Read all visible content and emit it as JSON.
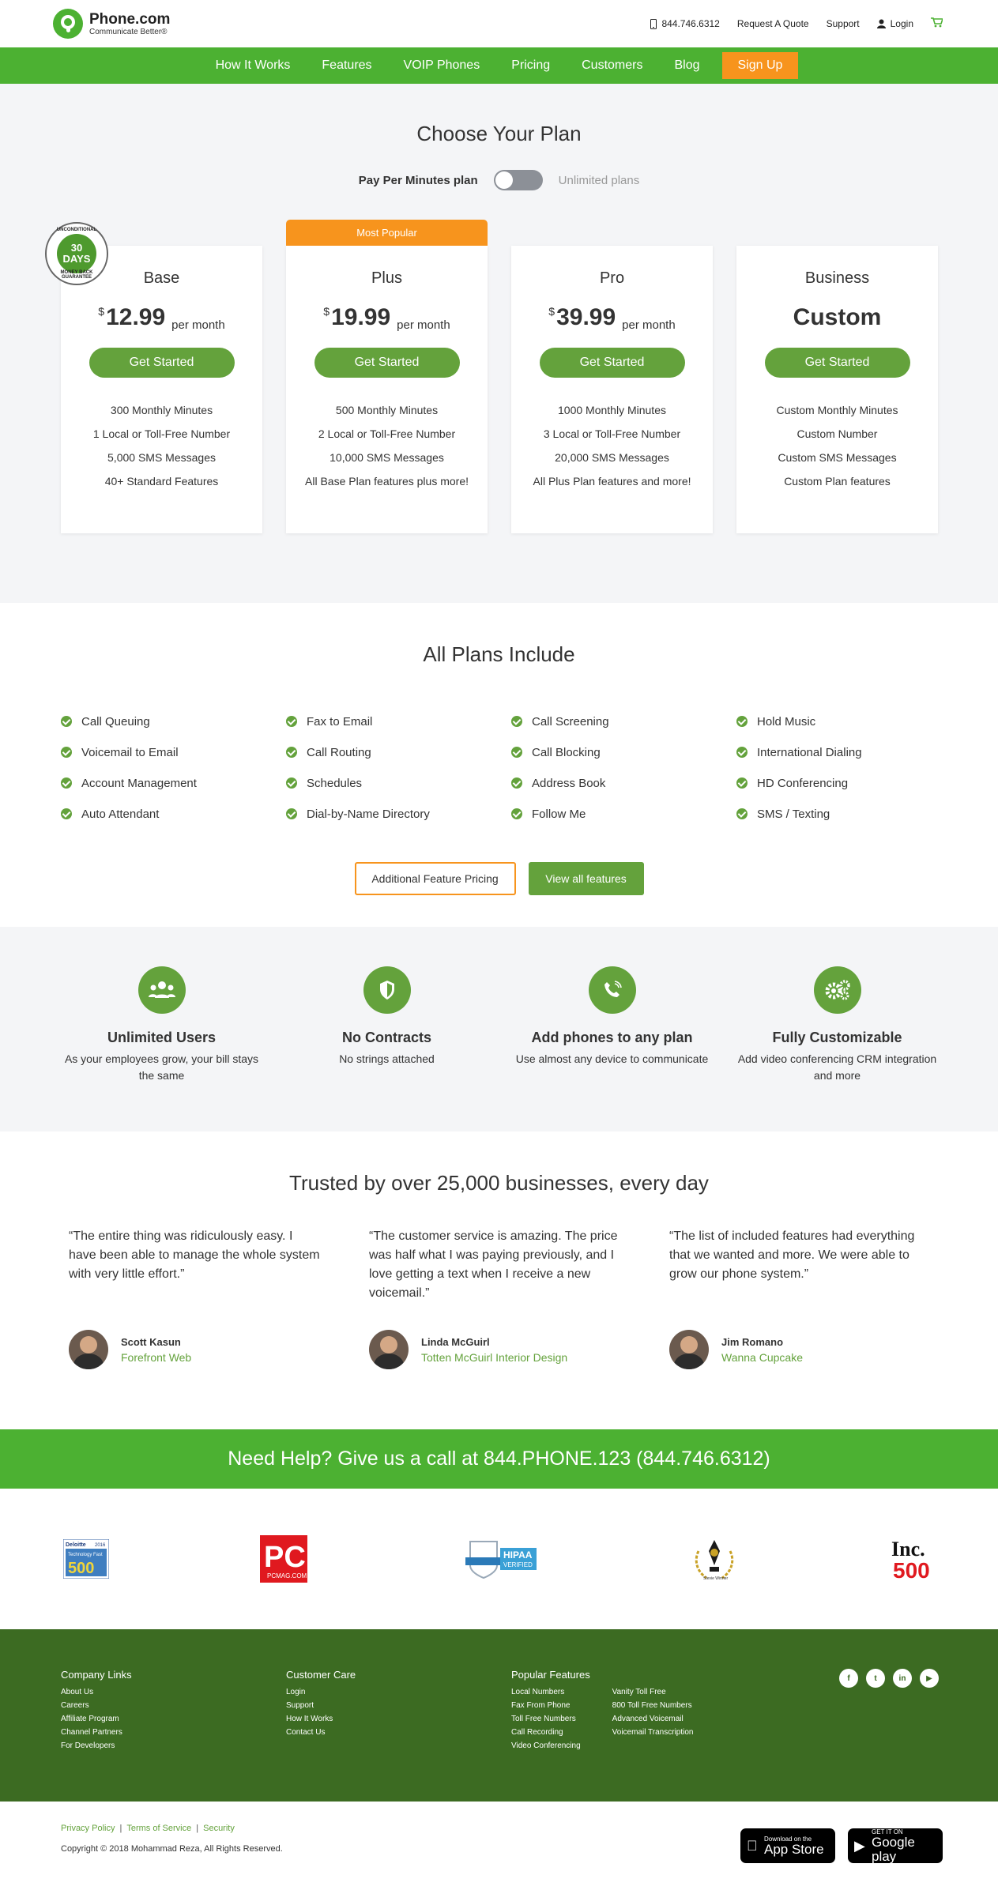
{
  "header": {
    "brand": "Phone.com",
    "tagline": "Communicate Better®",
    "phone": "844.746.6312",
    "quote": "Request A Quote",
    "support": "Support",
    "login": "Login"
  },
  "nav": {
    "items": [
      "How It Works",
      "Features",
      "VOIP Phones",
      "Pricing",
      "Customers",
      "Blog"
    ],
    "signup": "Sign Up"
  },
  "plans": {
    "title": "Choose Your Plan",
    "toggle_left": "Pay Per Minutes plan",
    "toggle_right": "Unlimited plans",
    "badge": {
      "top": "UNCONDITIONAL",
      "big": "30",
      "days": "DAYS",
      "bottom": "MONEY BACK GUARANTEE"
    },
    "most_popular": "Most Popular",
    "cards": [
      {
        "name": "Base",
        "currency": "$",
        "price": "12.99",
        "per": "per month",
        "cta": "Get Started",
        "features": [
          "300 Monthly Minutes",
          "1 Local or Toll-Free Number",
          "5,000 SMS Messages",
          "40+ Standard Features"
        ]
      },
      {
        "name": "Plus",
        "currency": "$",
        "price": "19.99",
        "per": "per month",
        "cta": "Get Started",
        "features": [
          "500 Monthly Minutes",
          "2 Local or Toll-Free Number",
          "10,000 SMS Messages",
          "All Base Plan features plus more!"
        ]
      },
      {
        "name": "Pro",
        "currency": "$",
        "price": "39.99",
        "per": "per month",
        "cta": "Get Started",
        "features": [
          "1000 Monthly Minutes",
          "3 Local or Toll-Free Number",
          "20,000 SMS Messages",
          "All Plus Plan features and more!"
        ]
      },
      {
        "name": "Business",
        "custom": "Custom",
        "cta": "Get Started",
        "features": [
          "Custom Monthly Minutes",
          "Custom Number",
          "Custom SMS Messages",
          "Custom Plan features"
        ]
      }
    ]
  },
  "include": {
    "title": "All Plans Include",
    "features": [
      "Call Queuing",
      "Fax to Email",
      "Call Screening",
      "Hold Music",
      "Voicemail to Email",
      "Call Routing",
      "Call Blocking",
      "International Dialing",
      "Account Management",
      "Schedules",
      "Address Book",
      "HD Conferencing",
      "Auto Attendant",
      "Dial-by-Name Directory",
      "Follow Me",
      "SMS / Texting"
    ],
    "btn_pricing": "Additional Feature Pricing",
    "btn_all": "View all features"
  },
  "benefits": [
    {
      "title": "Unlimited Users",
      "desc": "As your employees grow, your bill stays the same",
      "icon": "users-icon"
    },
    {
      "title": "No Contracts",
      "desc": "No strings attached",
      "icon": "shield-icon"
    },
    {
      "title": "Add phones to any plan",
      "desc": "Use almost any device to communicate",
      "icon": "phone-icon"
    },
    {
      "title": "Fully Customizable",
      "desc": "Add video conferencing CRM integration and more",
      "icon": "gears-icon"
    }
  ],
  "trust": {
    "title": "Trusted by over 25,000 businesses, every day",
    "quotes": [
      {
        "text": "“The entire thing was ridiculously easy. I have been able to manage the whole system with very little effort.”",
        "name": "Scott Kasun",
        "company": "Forefront Web"
      },
      {
        "text": "“The customer service is amazing. The price was half what I was paying previously, and I love getting a text when I receive a new voicemail.”",
        "name": "Linda McGuirl",
        "company": "Totten McGuirl Interior Design"
      },
      {
        "text": "“The list of included features had everything that we wanted and more. We were able to grow our phone system.”",
        "name": "Jim Romano",
        "company": "Wanna Cupcake"
      }
    ]
  },
  "help": "Need Help? Give us a call at 844.PHONE.123 (844.746.6312)",
  "awards": {
    "deloitte": {
      "a": "Deloitte",
      "b": "2016",
      "c": "Technology Fast",
      "d": "500"
    },
    "pc": {
      "a": "PC",
      "b": "PCMAG.COM"
    },
    "hipaa": {
      "a": "HIPAA",
      "b": "VERIFIED"
    },
    "stevie": "Stevie Winner",
    "inc": {
      "a": "Inc.",
      "b": "500"
    }
  },
  "footer": {
    "company": {
      "title": "Company Links",
      "links": [
        "About Us",
        "Careers",
        "Affiliate Program",
        "Channel Partners",
        "For Developers"
      ]
    },
    "care": {
      "title": "Customer Care",
      "links": [
        "Login",
        "Support",
        "How It Works",
        "Contact Us"
      ]
    },
    "popular": {
      "title": "Popular Features",
      "col1": [
        "Local Numbers",
        "Fax From Phone",
        "Toll Free Numbers",
        "Call Recording",
        "Video Conferencing"
      ],
      "col2": [
        "Vanity Toll Free",
        "800 Toll Free Numbers",
        "Advanced Voicemail",
        "Voicemail Transcription"
      ]
    },
    "social": [
      "f",
      "t",
      "in",
      "▶"
    ]
  },
  "bottom": {
    "privacy": "Privacy Policy",
    "terms": "Terms of Service",
    "security": "Security",
    "copyright": "Copyright © 2018 Mohammad Reza, All Rights Reserved.",
    "appstore": {
      "a": "Download on the",
      "b": "App Store"
    },
    "google": {
      "a": "GET IT ON",
      "b": "Google play"
    }
  },
  "colors": {
    "green": "#4cb132",
    "dark_green": "#3c6b22",
    "button_green": "#64a23c",
    "orange": "#f7941d"
  }
}
